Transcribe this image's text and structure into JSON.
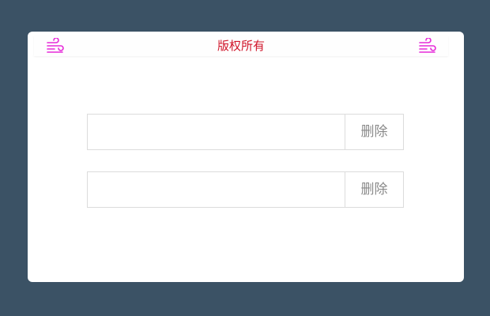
{
  "header": {
    "title": "版权所有",
    "icon_left": "wind-icon",
    "icon_right": "wind-icon",
    "icon_color": "#e62ad8",
    "title_color": "#d0152a"
  },
  "rows": [
    {
      "value": "",
      "button_label": "删除"
    },
    {
      "value": "",
      "button_label": "删除"
    }
  ],
  "colors": {
    "background": "#3b5265",
    "card": "#ffffff",
    "border": "#dcdcdc",
    "button_text": "#8a8a8a"
  }
}
